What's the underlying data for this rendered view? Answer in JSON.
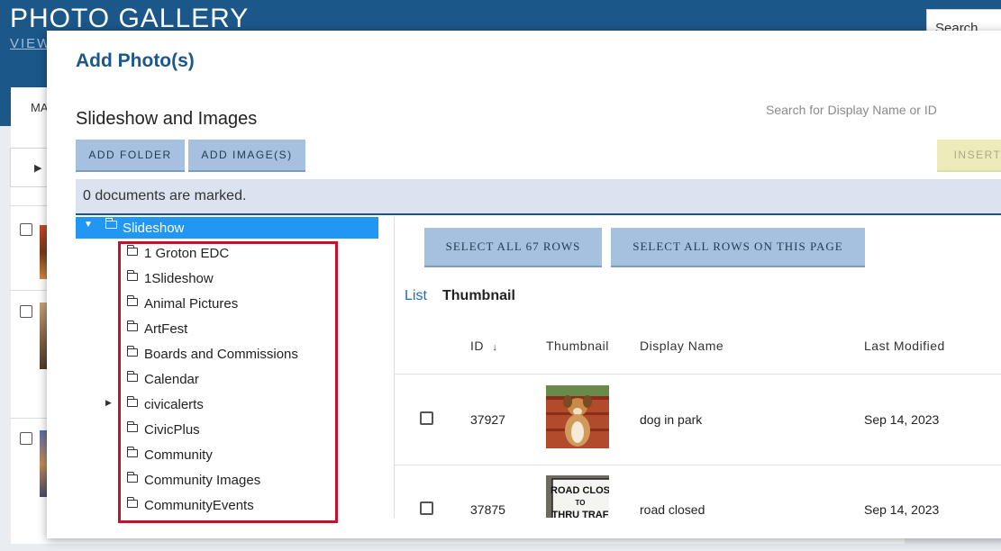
{
  "background": {
    "title": "PHOTO GALLERY",
    "subtitle": "VIEW",
    "tab_label": "MA",
    "search_placeholder": "Search"
  },
  "modal": {
    "title": "Add Photo(s)",
    "section_title": "Slideshow and Images",
    "search_placeholder": "Search for Display Name or ID",
    "buttons": {
      "add_folder": "ADD FOLDER",
      "add_images": "ADD IMAGE(S)",
      "insert": "INSERT"
    },
    "marked_text": "0 documents are marked.",
    "tree": {
      "root": "Slideshow",
      "items": [
        {
          "label": "1 Groton EDC",
          "expandable": false
        },
        {
          "label": "1Slideshow",
          "expandable": false
        },
        {
          "label": "Animal Pictures",
          "expandable": false
        },
        {
          "label": "ArtFest",
          "expandable": false
        },
        {
          "label": "Boards and Commissions",
          "expandable": false
        },
        {
          "label": "Calendar",
          "expandable": false
        },
        {
          "label": "civicalerts",
          "expandable": true
        },
        {
          "label": "CivicPlus",
          "expandable": false
        },
        {
          "label": "Community",
          "expandable": false
        },
        {
          "label": "Community Images",
          "expandable": false
        },
        {
          "label": "CommunityEvents",
          "expandable": false
        }
      ]
    },
    "table": {
      "select_all": "SELECT ALL 67 ROWS",
      "select_page": "SELECT ALL ROWS ON THIS PAGE",
      "view_list": "List",
      "view_thumbnail": "Thumbnail",
      "headers": {
        "id": "ID",
        "thumbnail": "Thumbnail",
        "display_name": "Display Name",
        "last_modified": "Last Modified"
      },
      "rows": [
        {
          "id": "37927",
          "display_name": "dog in park",
          "last_modified": "Sep 14, 2023"
        },
        {
          "id": "37875",
          "display_name": "road closed",
          "last_modified": "Sep 14, 2023"
        }
      ],
      "thumb2_sign_text": [
        "ROAD CLOS",
        "TO",
        "THRU TRAF"
      ]
    }
  }
}
